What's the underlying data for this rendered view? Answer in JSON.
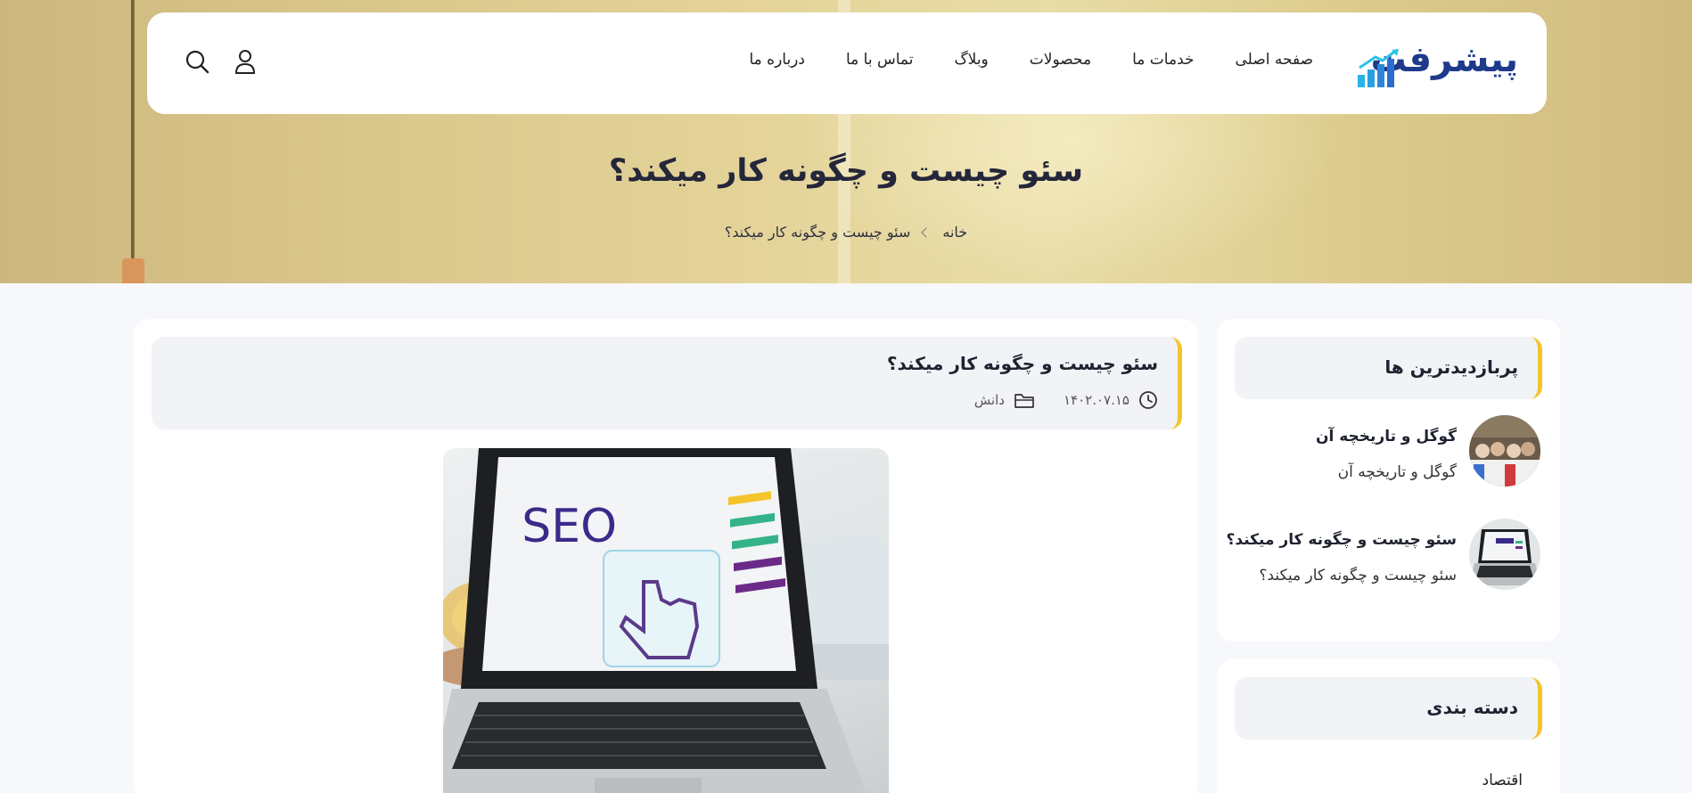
{
  "header": {
    "logo_text": "پیشرفت",
    "nav": [
      "صفحه اصلی",
      "خدمات ما",
      "محصولات",
      "وبلاگ",
      "تماس با ما",
      "درباره ما"
    ],
    "icons": [
      "user-icon",
      "search-icon"
    ]
  },
  "hero": {
    "title": "سئو چیست و چگونه کار میکند؟",
    "breadcrumb": {
      "home": "خانه",
      "current": "سئو چیست و چگونه کار میکند؟"
    }
  },
  "post": {
    "title": "سئو چیست و چگونه کار میکند؟",
    "date": "۱۴۰۲.۰۷.۱۵",
    "category": "دانش",
    "image_text": "SEO"
  },
  "sidebar": {
    "popular": {
      "title": "پربازدیدترین ها",
      "items": [
        {
          "title": "گوگل و تاریخچه آن",
          "subtitle": "گوگل و تاریخچه آن"
        },
        {
          "title": "سئو چیست و چگونه کار میکند؟",
          "subtitle": "سئو چیست و چگونه کار میکند؟"
        }
      ]
    },
    "categories": {
      "title": "دسته بندی",
      "items": [
        "اقتصاد"
      ]
    }
  },
  "colors": {
    "accent": "#f5c42c",
    "brand": "#1e3a8a",
    "hero_bg": "#e4d49a"
  }
}
